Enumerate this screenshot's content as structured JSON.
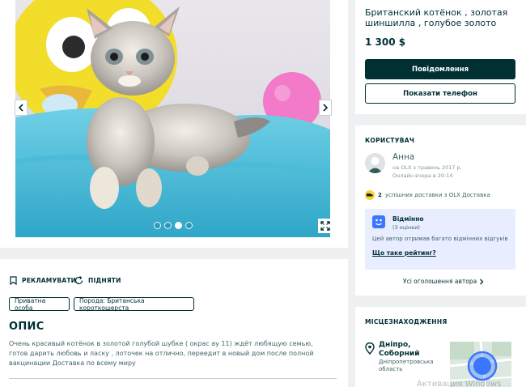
{
  "gallery": {
    "prev_icon": "chevron-left-icon",
    "next_icon": "chevron-right-icon",
    "expand_icon": "expand-icon",
    "dots_total": 4,
    "dots_active": 3
  },
  "actions": {
    "promote_label": "РЕКЛАМУВАТИ",
    "bump_label": "ПІДНЯТИ"
  },
  "tags": [
    "Приватна особа",
    "Порода: Британська короткошерста"
  ],
  "description": {
    "title": "ОПИС",
    "text": "Очень красивый котёнок в золотой голубой шубке ( окрас ау 11) ждёт любящую семью, готов дарить любовь и ласку , лоточек на отлично, переедит в новый дом после полной вакцинации Доставка по всему миру"
  },
  "listing": {
    "title": "Британский котёнок , золотая шиншилла , голубое золото",
    "price": "1 300 $",
    "message_button": "Повідомлення",
    "phone_button": "Показати телефон"
  },
  "user": {
    "heading": "КОРИСТУВАЧ",
    "name": "Анна",
    "since": "на OLX з травень 2017 р.",
    "online": "Онлайн вчора в 20:14",
    "deliveries_count": "2",
    "deliveries_text": "успішних доставки з OLX Доставка",
    "rating_label": "Відмінно",
    "rating_count": "(3 оцінки)",
    "rating_desc": "Цей автор отримав багато відмінних відгуків",
    "rating_link": "Що таке рейтинг?",
    "all_ads": "Усі оголошення автора"
  },
  "location": {
    "heading": "МІСЦЕЗНАХОДЖЕННЯ",
    "city_line1": "Дніпро,",
    "city_line2": "Соборний",
    "region": "Дніпропетровська область"
  },
  "watermark": "Активация Windows",
  "colors": {
    "primary": "#002f34",
    "rating_bg": "#e8edff",
    "rating_icon": "#3a77ff",
    "delivery_badge": "#ffce32"
  }
}
